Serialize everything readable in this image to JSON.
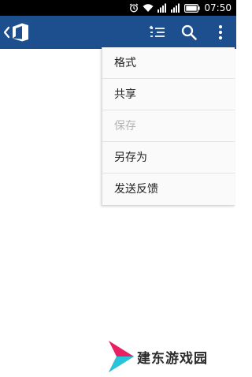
{
  "status_bar": {
    "time": "07:50",
    "icons": [
      "alarm-icon",
      "wifi-icon",
      "signal-icon",
      "signal-icon",
      "battery-icon"
    ]
  },
  "app_bar": {
    "background_color": "#1d4f8f",
    "icons": [
      "back-chevron-icon",
      "office-logo-icon",
      "outline-view-icon",
      "search-icon",
      "more-vert-icon"
    ]
  },
  "menu": {
    "items": [
      {
        "label": "格式",
        "enabled": true
      },
      {
        "label": "共享",
        "enabled": true
      },
      {
        "label": "保存",
        "enabled": false
      },
      {
        "label": "另存为",
        "enabled": true
      },
      {
        "label": "发送反馈",
        "enabled": true
      }
    ]
  },
  "watermark": {
    "text": "建东游戏园",
    "colors": [
      "#e91e63",
      "#26c6da"
    ]
  }
}
